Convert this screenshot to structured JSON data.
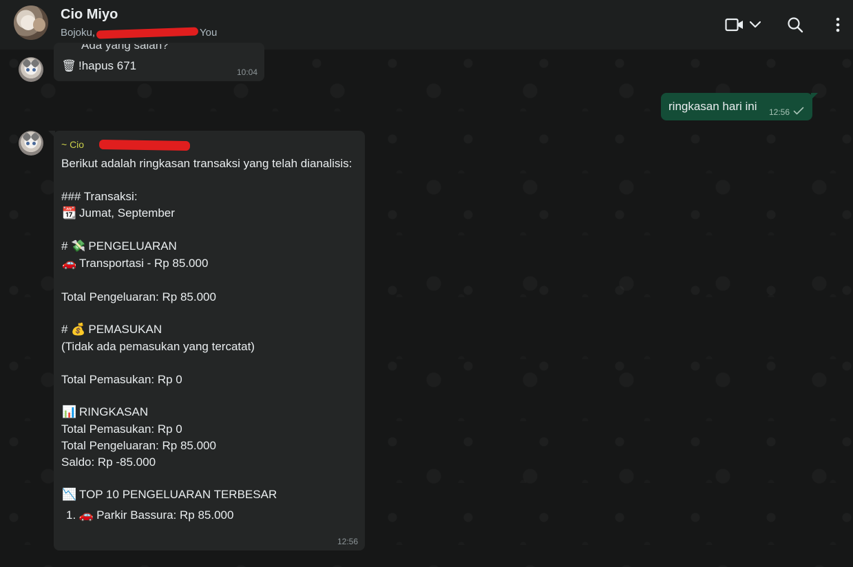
{
  "header": {
    "title": "Cio Miyo",
    "members_visible_start": "Bojoku,",
    "members_visible_end": "You"
  },
  "messages": [
    {
      "id": "m1",
      "direction": "in",
      "partial_top_line": "Ada yang salah?",
      "text": "!hapus 671",
      "time": "10:04",
      "icon": "trash-emoji"
    },
    {
      "id": "m2",
      "direction": "out",
      "text": "ringkasan hari ini",
      "time": "12:56",
      "status": "sent-single-check"
    },
    {
      "id": "m3",
      "direction": "in",
      "sender": "~ Cio",
      "time": "12:56",
      "lines": [
        {
          "emoji": "",
          "text": "Berikut adalah ringkasan transaksi yang telah dianalisis:"
        },
        {
          "emoji": "",
          "text": "### Transaksi:"
        },
        {
          "emoji": "📆",
          "text": "Jumat, September"
        },
        {
          "emoji": "# 💸",
          "text": "PENGELUARAN"
        },
        {
          "emoji": "🚗",
          "text": "Transportasi - Rp 85.000"
        },
        {
          "emoji": "",
          "text": "Total Pengeluaran: Rp 85.000"
        },
        {
          "emoji": "# 💰",
          "text": "PEMASUKAN"
        },
        {
          "emoji": "",
          "text": "(Tidak ada pemasukan yang tercatat)"
        },
        {
          "emoji": "",
          "text": "Total Pemasukan: Rp 0"
        },
        {
          "emoji": "📊",
          "text": "RINGKASAN"
        },
        {
          "emoji": "",
          "text": "Total Pemasukan: Rp 0"
        },
        {
          "emoji": "",
          "text": "Total Pengeluaran: Rp 85.000"
        },
        {
          "emoji": "",
          "text": "Saldo: Rp -85.000"
        },
        {
          "emoji": "📉",
          "text": "TOP 10 PENGELUARAN TERBESAR"
        },
        {
          "emoji": "1. 🚗",
          "text": "Parkir Bassura: Rp 85.000"
        }
      ]
    }
  ],
  "icons": {
    "video": "video-call-icon",
    "dropdown": "chevron-down-icon",
    "search": "search-icon",
    "menu": "kebab-menu-icon"
  },
  "colors": {
    "header_bg": "#1d1f1f",
    "incoming_bubble": "#242626",
    "outgoing_bubble": "#144d37",
    "sender_name": "#cbd04a",
    "redaction": "#e01e1e"
  }
}
